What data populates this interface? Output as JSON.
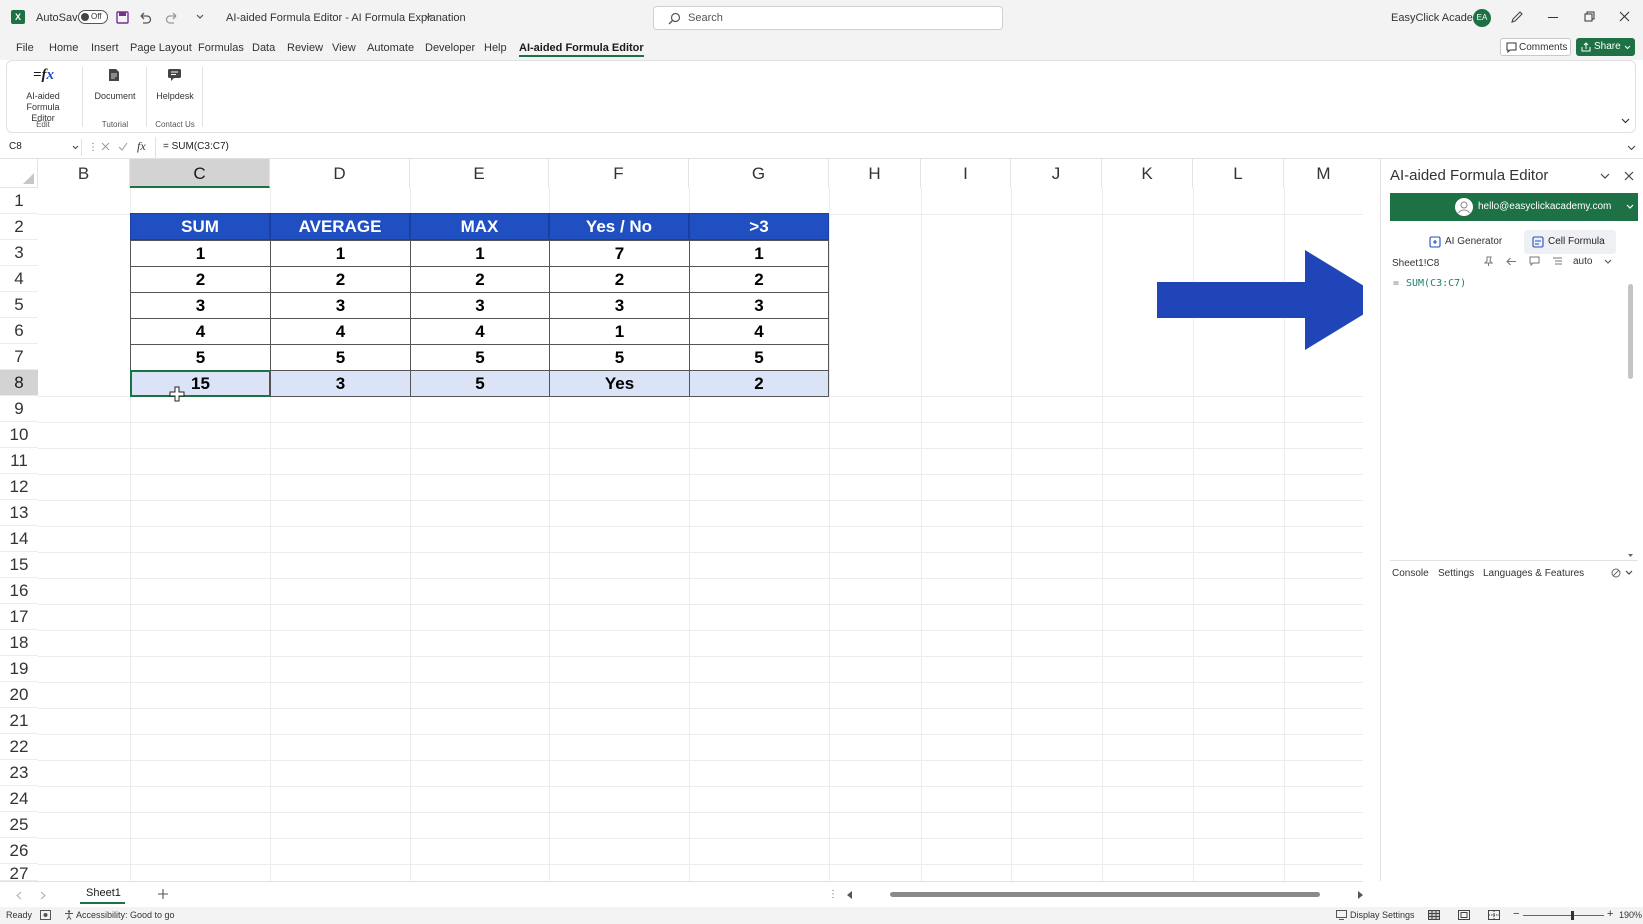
{
  "titlebar": {
    "autosave_label": "AutoSave",
    "autosave_state": "Off",
    "title": "AI-aided Formula Editor - AI Formula Explanation",
    "search_placeholder": "Search",
    "account": "EasyClick Academy",
    "avatar_initials": "EA"
  },
  "menu": {
    "tabs": [
      "File",
      "Home",
      "Insert",
      "Page Layout",
      "Formulas",
      "Data",
      "Review",
      "View",
      "Automate",
      "Developer",
      "Help",
      "AI-aided Formula Editor"
    ],
    "active_tab": "AI-aided Formula Editor",
    "comments_label": "Comments",
    "share_label": "Share"
  },
  "ribbon": {
    "buttons": [
      {
        "label": "AI-aided Formula Editor",
        "group": "Edit"
      },
      {
        "label": "Document",
        "group": "Tutorial"
      },
      {
        "label": "Helpdesk",
        "group": "Contact Us"
      }
    ]
  },
  "formula_bar": {
    "name_box": "C8",
    "formula": "= SUM(C3:C7)"
  },
  "grid": {
    "columns": [
      "B",
      "C",
      "D",
      "E",
      "F",
      "G",
      "H",
      "I",
      "J",
      "K",
      "L",
      "M"
    ],
    "selected_column": "C",
    "rows": [
      "1",
      "2",
      "3",
      "4",
      "5",
      "6",
      "7",
      "8",
      "9",
      "10",
      "11",
      "12",
      "13",
      "14",
      "15",
      "16",
      "17",
      "18",
      "19",
      "20",
      "21",
      "22",
      "23",
      "24",
      "25",
      "26",
      "27"
    ],
    "selected_row": "8"
  },
  "table": {
    "headers": [
      "SUM",
      "AVERAGE",
      "MAX",
      "Yes / No",
      ">3"
    ],
    "rows": [
      [
        "1",
        "1",
        "1",
        "7",
        "1"
      ],
      [
        "2",
        "2",
        "2",
        "2",
        "2"
      ],
      [
        "3",
        "3",
        "3",
        "3",
        "3"
      ],
      [
        "4",
        "4",
        "4",
        "1",
        "4"
      ],
      [
        "5",
        "5",
        "5",
        "5",
        "5"
      ]
    ],
    "totals": [
      "15",
      "3",
      "5",
      "Yes",
      "2"
    ],
    "header_color": "#1f4fc1",
    "total_color": "#dbe3f6"
  },
  "annotation": {
    "arrow_color": "#1f45b8"
  },
  "panel": {
    "title": "AI-aided Formula Editor",
    "email": "hello@easyclickacademy.com",
    "brand_color": "#1e7145",
    "tab_ai_generator": "AI Generator",
    "tab_cell_formula": "Cell Formula",
    "cell_ref": "Sheet1!C8",
    "mode": "auto",
    "formula_prefix": "=",
    "formula": "SUM(C3:C7)",
    "bottom_tabs": [
      "Console",
      "Settings",
      "Languages & Features"
    ]
  },
  "sheets": {
    "active": "Sheet1"
  },
  "status": {
    "ready": "Ready",
    "accessibility": "Accessibility: Good to go",
    "display_settings": "Display Settings",
    "zoom": "190%"
  }
}
